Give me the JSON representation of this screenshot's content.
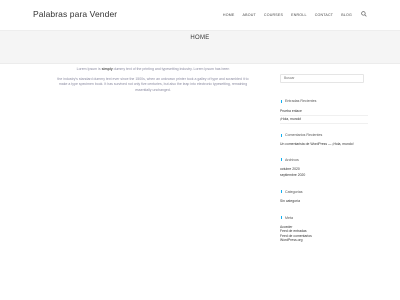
{
  "site": {
    "title": "Palabras para Vender"
  },
  "nav": {
    "items": [
      "HOME",
      "ABOUT",
      "COURSES",
      "ENROLL",
      "CONTACT",
      "BLOG"
    ]
  },
  "page": {
    "title": "HOME"
  },
  "content": {
    "paragraph1_pre": "Lorem Ipsum is ",
    "paragraph1_bold": "simply",
    "paragraph1_post": " dummy text of the printing and typesetting industry. Lorem Ipsum has been",
    "paragraph2": "the industry's standard dummy text ever since the 1500s, when an unknown printer took a galley of type and scrambled it to make a type specimen book. It has survived not only five centuries, but also the leap into electronic typesetting, remaining essentially unchanged."
  },
  "sidebar": {
    "search": {
      "placeholder": "Buscar"
    },
    "recent_posts": {
      "title": "Entradas Recientes",
      "items": [
        "Prueba enlace",
        "¡Hola, mundo!"
      ]
    },
    "recent_comments": {
      "title": "Comentarios Recientes",
      "items": [
        "Un comentarista de WordPress — ¡Hola, mundo!"
      ]
    },
    "archives": {
      "title": "Archivos",
      "items": [
        "octubre 2020",
        "septiembre 2020"
      ]
    },
    "categories": {
      "title": "Categorías",
      "items": [
        "Sin categoría"
      ]
    },
    "meta": {
      "title": "Meta",
      "items": [
        "Acceder",
        "Feed de entradas",
        "Feed de comentarios",
        "WordPress.org"
      ]
    }
  },
  "colors": {
    "accent": "#13aff0",
    "hero_bg": "#f5f5f5"
  },
  "icons": {
    "search": "search-icon"
  }
}
